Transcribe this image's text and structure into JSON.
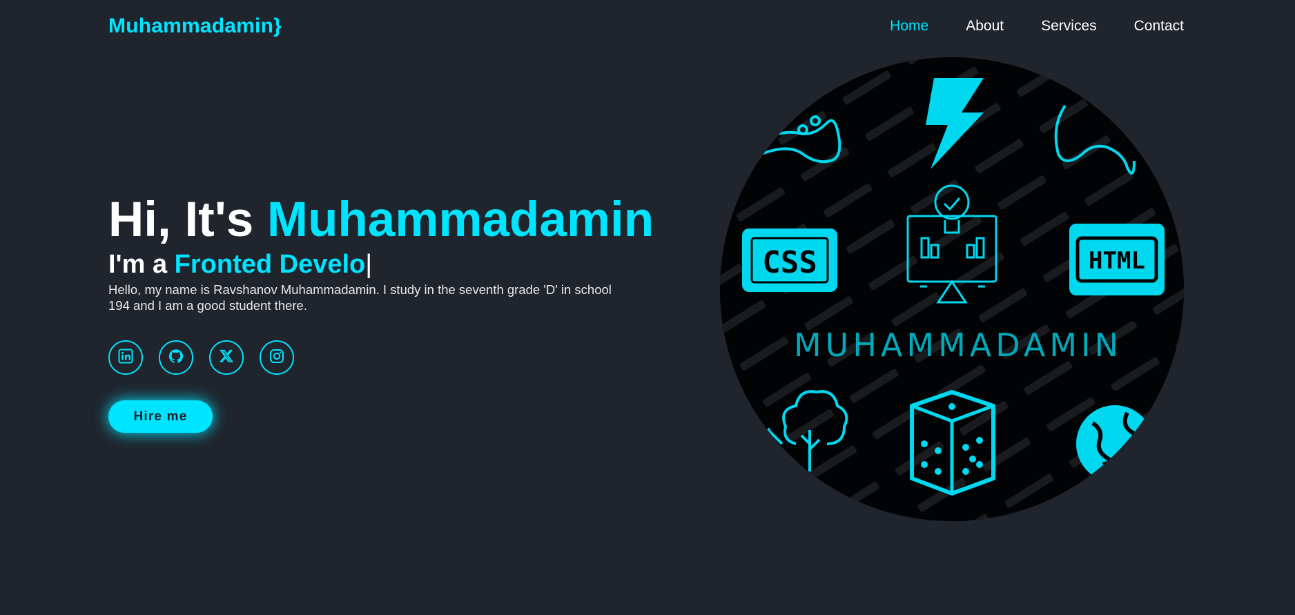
{
  "header": {
    "logo": "Muhammadamin}",
    "nav": [
      {
        "label": "Home",
        "active": true
      },
      {
        "label": "About",
        "active": false
      },
      {
        "label": "Services",
        "active": false
      },
      {
        "label": "Contact",
        "active": false
      }
    ]
  },
  "hero": {
    "title_prefix": "Hi, It's ",
    "title_name": "Muhammadamin",
    "subtitle_prefix": "I'm a ",
    "subtitle_typed": "Fronted Develo",
    "subtitle_caret": "|",
    "description": "Hello, my name is Ravshanov Muhammadamin. I study in the seventh grade 'D' in school 194 and I am a good student there.",
    "hire_label": "Hire me"
  },
  "socials": [
    {
      "icon": "linkedin-icon"
    },
    {
      "icon": "github-icon"
    },
    {
      "icon": "x-icon"
    },
    {
      "icon": "instagram-icon"
    }
  ],
  "portrait": {
    "badge_css": "CSS",
    "badge_html": "HTML",
    "name_text": "MUHAMMADAMIN"
  },
  "colors": {
    "background": "#1f242d",
    "accent": "#00e5ff",
    "text": "#ffffff"
  }
}
